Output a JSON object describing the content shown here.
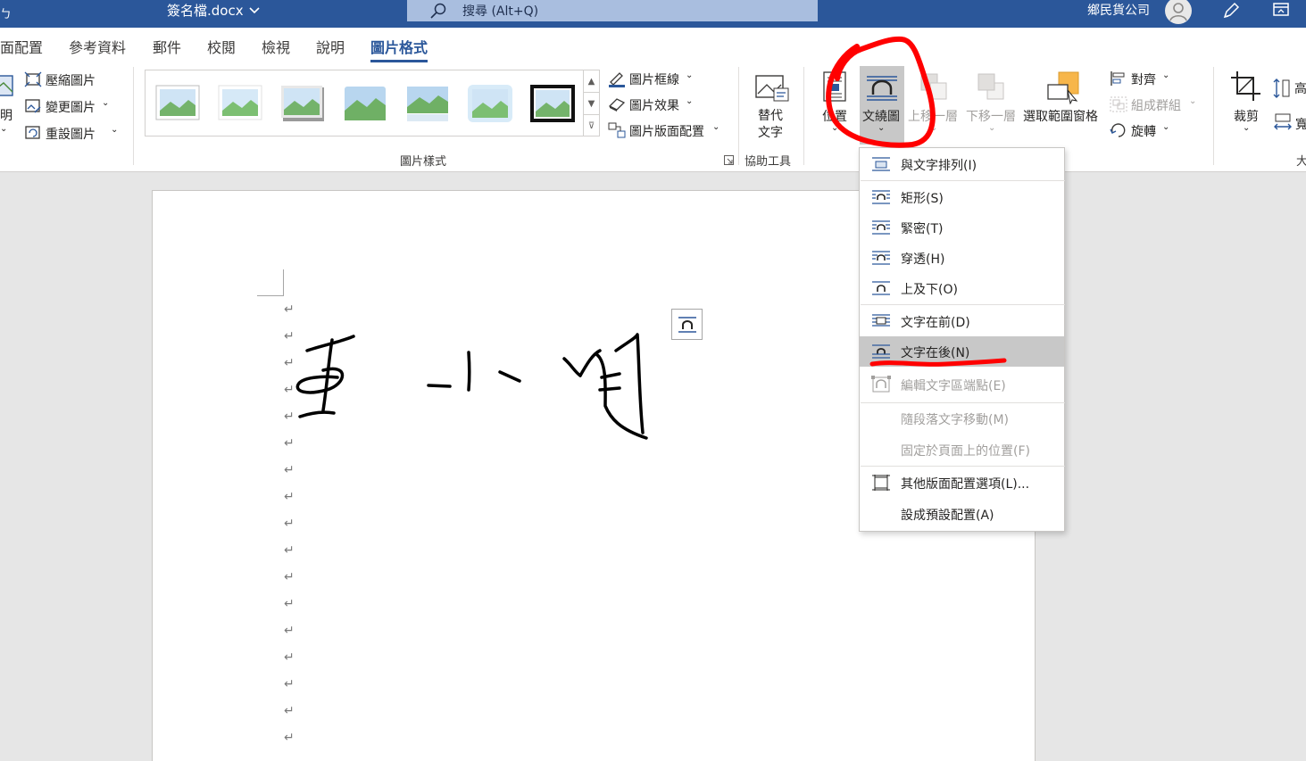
{
  "titlebar": {
    "left_glyph": "ㄅ",
    "doc_title": "簽名檔.docx",
    "search_placeholder": "搜尋 (Alt+Q)",
    "account": "鄉民貨公司"
  },
  "tabs": [
    {
      "label": "面配置"
    },
    {
      "label": "參考資料"
    },
    {
      "label": "郵件"
    },
    {
      "label": "校閱"
    },
    {
      "label": "檢視"
    },
    {
      "label": "說明"
    },
    {
      "label": "圖片格式",
      "active": true
    }
  ],
  "ribbon": {
    "adjust": {
      "partial_top": "明",
      "compress": "壓縮圖片",
      "change": "變更圖片",
      "reset": "重設圖片"
    },
    "picture_styles_label": "圖片樣式",
    "border": "圖片框線",
    "effects": "圖片效果",
    "layout": "圖片版面配置",
    "alt_text_line1": "替代",
    "alt_text_line2": "文字",
    "accessibility_label": "協助工具",
    "position": "位置",
    "wrap_text": "文繞圖",
    "bring_forward": "上移一層",
    "send_backward": "下移一層",
    "selection_pane": "選取範圍窗格",
    "align": "對齊",
    "group": "組成群組",
    "rotate": "旋轉",
    "crop": "裁剪",
    "height_partial": "高",
    "width_partial": "寬",
    "size_partial": "大"
  },
  "wrap_menu": {
    "items": [
      {
        "label": "與文字排列(I)",
        "enabled": true
      },
      {
        "label": "矩形(S)",
        "enabled": true
      },
      {
        "label": "緊密(T)",
        "enabled": true
      },
      {
        "label": "穿透(H)",
        "enabled": true
      },
      {
        "label": "上及下(O)",
        "enabled": true
      },
      {
        "label": "文字在前(D)",
        "enabled": true
      },
      {
        "label": "文字在後(N)",
        "enabled": true,
        "selected": true
      },
      {
        "label": "編輯文字區端點(E)",
        "enabled": false
      },
      {
        "label": "隨段落文字移動(M)",
        "enabled": false
      },
      {
        "label": "固定於頁面上的位置(F)",
        "enabled": false
      },
      {
        "label": "其他版面配置選項(L)...",
        "enabled": true
      },
      {
        "label": "設成預設配置(A)",
        "enabled": true
      }
    ]
  },
  "document": {
    "paragraph_mark": "↵",
    "paragraph_count": 17
  },
  "colors": {
    "accent": "#2b579a",
    "annotation": "#ff0000",
    "menu_selected": "#c8c8c8"
  }
}
